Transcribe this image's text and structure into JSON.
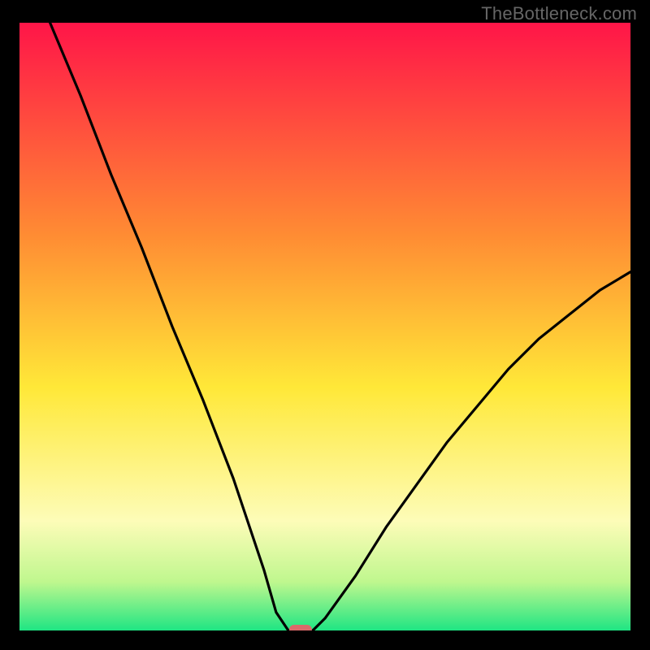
{
  "watermark": "TheBottleneck.com",
  "chart_data": {
    "type": "line",
    "title": "",
    "xlabel": "",
    "ylabel": "",
    "xlim": [
      0,
      100
    ],
    "ylim": [
      0,
      100
    ],
    "x": [
      5,
      10,
      15,
      20,
      25,
      30,
      35,
      40,
      42,
      44,
      45,
      46,
      48,
      50,
      55,
      60,
      65,
      70,
      75,
      80,
      85,
      90,
      95,
      100
    ],
    "values": [
      100,
      88,
      75,
      63,
      50,
      38,
      25,
      10,
      3,
      0,
      0,
      0,
      0,
      2,
      9,
      17,
      24,
      31,
      37,
      43,
      48,
      52,
      56,
      59
    ],
    "minimum_region": {
      "x_start": 43,
      "x_end": 49,
      "y": 0
    },
    "marker": {
      "x": 46,
      "y": 0,
      "color": "#DB6A6A"
    },
    "background_gradient": {
      "type": "vertical",
      "stops": [
        {
          "offset": 0,
          "color": "#FF1548"
        },
        {
          "offset": 35,
          "color": "#FF8C33"
        },
        {
          "offset": 60,
          "color": "#FFE838"
        },
        {
          "offset": 82,
          "color": "#FDFCB8"
        },
        {
          "offset": 92,
          "color": "#BFF78E"
        },
        {
          "offset": 100,
          "color": "#1FE583"
        }
      ]
    }
  }
}
